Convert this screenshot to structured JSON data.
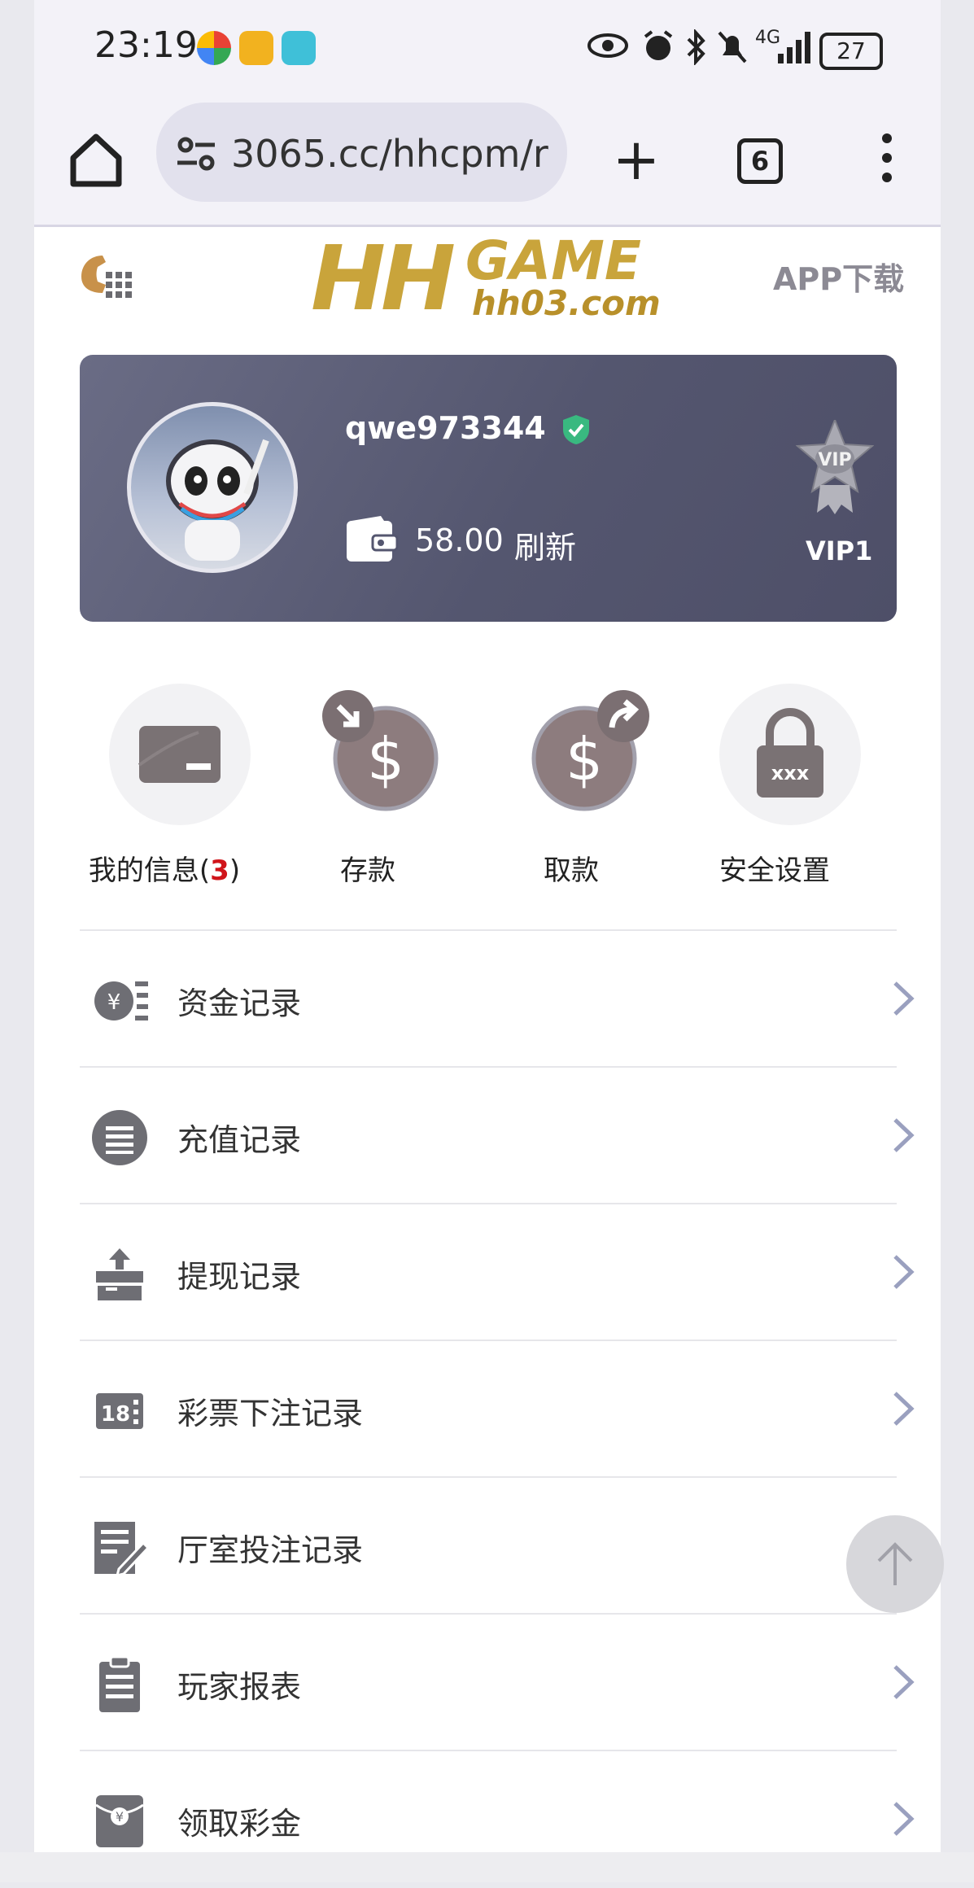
{
  "status_bar": {
    "time": "23:19",
    "network": "4G",
    "battery": "27"
  },
  "browser": {
    "url": "3065.cc/hhcpm/r",
    "tab_count": "6"
  },
  "header": {
    "logo_main": "HH",
    "logo_game": "GAME",
    "logo_domain": "hh03.com",
    "app_download": "APP下载"
  },
  "user": {
    "username": "qwe973344",
    "balance": "58.00",
    "refresh_label": "刷新",
    "vip_level": "VIP1"
  },
  "quick_actions": [
    {
      "label": "我的信息(",
      "count": "3",
      "suffix": ")",
      "icon": "message-card-icon"
    },
    {
      "label": "存款",
      "icon": "deposit-dollar-icon"
    },
    {
      "label": "取款",
      "icon": "withdraw-dollar-icon"
    },
    {
      "label": "安全设置",
      "icon": "lock-icon"
    }
  ],
  "menu_items": [
    {
      "label": "资金记录",
      "icon": "yen-ledger-icon"
    },
    {
      "label": "充值记录",
      "icon": "list-circle-icon"
    },
    {
      "label": "提现记录",
      "icon": "upload-box-icon"
    },
    {
      "label": "彩票下注记录",
      "icon": "lottery-18-icon"
    },
    {
      "label": "厅室投注记录",
      "icon": "edit-note-icon"
    },
    {
      "label": "玩家报表",
      "icon": "clipboard-icon"
    },
    {
      "label": "领取彩金",
      "icon": "red-envelope-icon"
    }
  ],
  "colors": {
    "card_bg": "#54566f",
    "logo_gold": "#c9a43b",
    "icon_gray": "#6e6e74",
    "badge_red": "#d0141a",
    "verified_green": "#39b980"
  }
}
